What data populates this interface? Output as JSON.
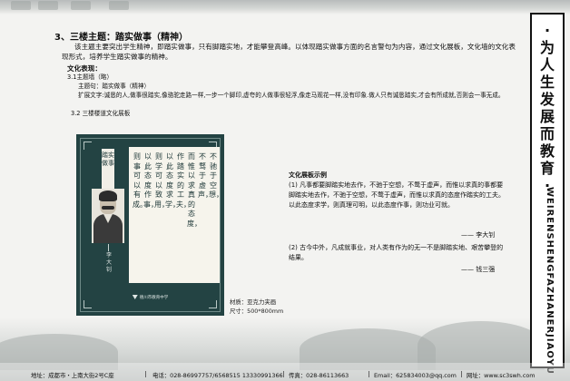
{
  "heading": "3、三楼主题：踏实做事（精神）",
  "intro": "该主题主要突出学生精神，即踏实做事，只有脚踏实地，才能攀登高峰。以体现踏实做事方面的名言警句为内容，通过文化展板，文化墙的文化表现形式，培养学生踏实做事的精神。",
  "culture_label": "文化表现：",
  "item_1": "3.1主题墙（略）",
  "theme_line": "主题句：踏实做事（精神）",
  "expand_text": "扩展文字:诚恳的人,做事很踏实,像骆驼走路一样,一步一个脚印,虚夸的人做事很轻浮,像走马观花一样,没有印象.做人只有诚恳踏实,才会有所成就,否则会一事无成。",
  "item_2": "3.2 三楼楼道文化展板",
  "board": {
    "title": "踏实做事",
    "author": "李大钊",
    "poem_columns": [
      "不驰于空想，",
      "不骛于虚声，",
      "而惟以求真的态度，",
      "作踏实的工夫，",
      "以此态度求学，",
      "则学可以致用，",
      "以此态度作事，",
      "则事可以有成。"
    ],
    "school": "德川市教育中学"
  },
  "material_line": "材质：亚克力夹画",
  "size_line": "尺寸：500*800mm",
  "example": {
    "title": "文化展板示例",
    "quote_1": "(1) 凡事都要脚踏实地去作，不驰于空想，不鹜于虚声，而惟以求真的事都要脚踏实地去作，不驰于空想，不鹜于虚声，而惟以求真的态度作踏实的工夫。以此态度求学，则真理可明，以此态度作事，则功业可就。",
    "sign_1": "—— 李大钊",
    "quote_2": "(2) 古今中外，凡成就事业，对人类有作为的无一不是脚踏实地、艰苦攀登的结果。",
    "sign_2": "—— 钱三强"
  },
  "slogan": {
    "cn": [
      "·",
      "为",
      "人",
      "生",
      "发",
      "展",
      "而",
      "教",
      "育",
      "·"
    ],
    "en": "WEIRENSHENGFAZHANERJIAOYU"
  },
  "footer": {
    "address": "地址：成都市・上南大街2号C座",
    "phone": "电话：028-86997757/6568515 13330991366",
    "fax": "传真：028-86113663",
    "email": "Email：625834003@qq.com",
    "website": "网址：www.sc3swh.com"
  }
}
